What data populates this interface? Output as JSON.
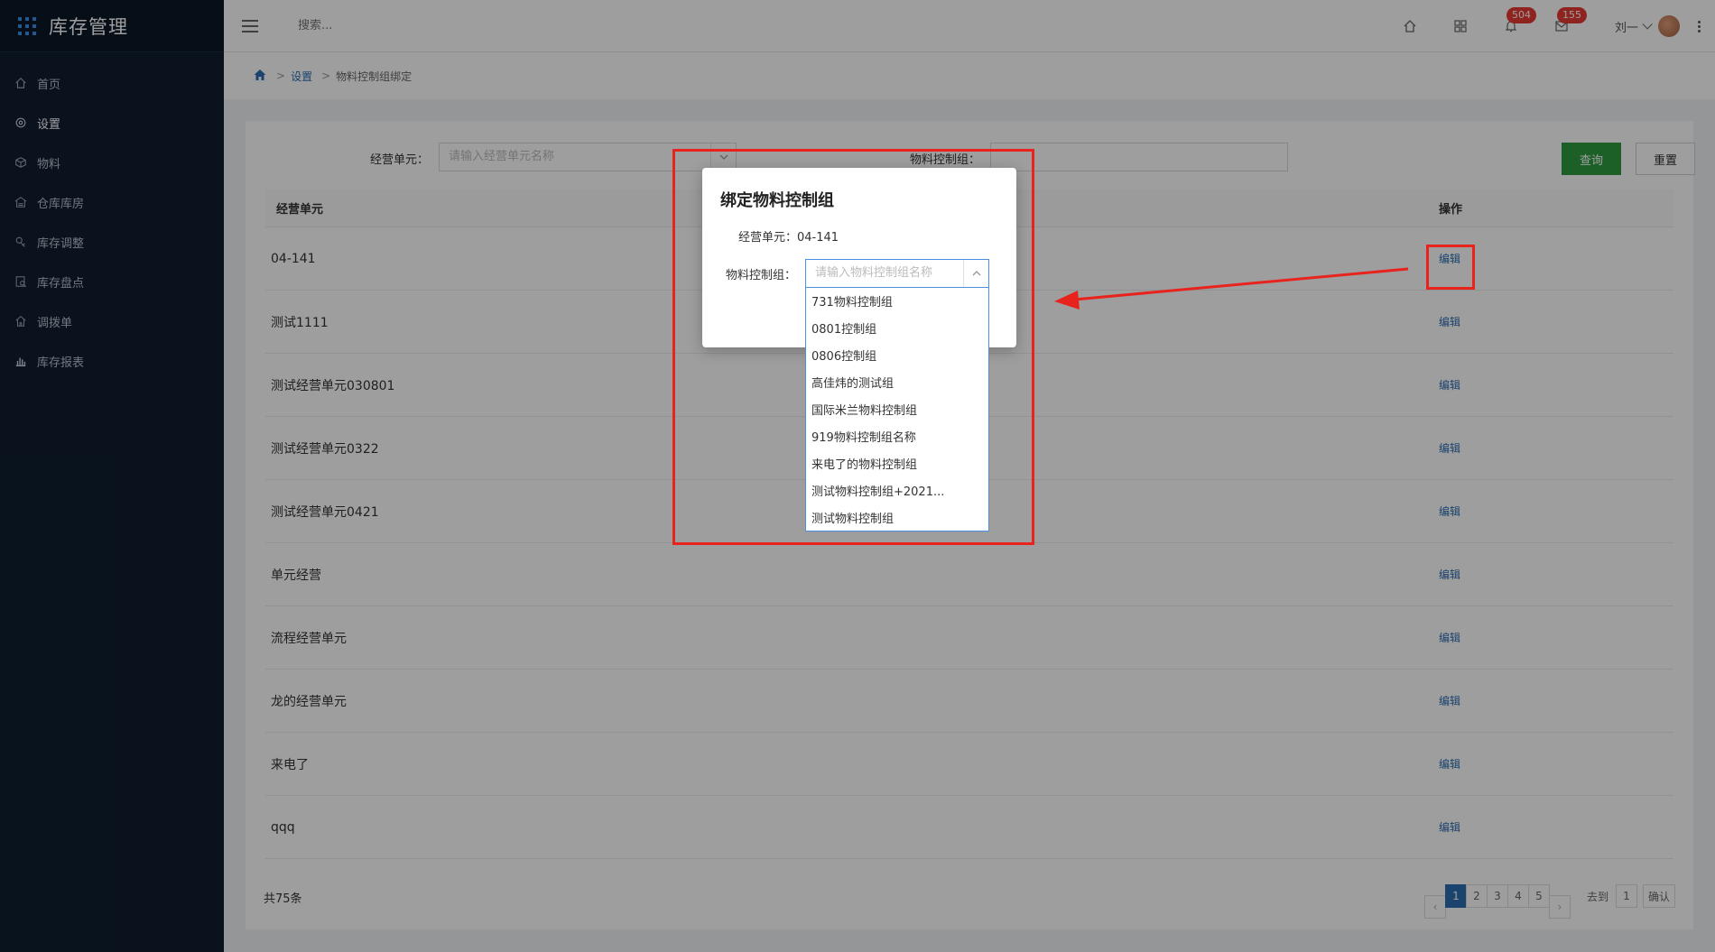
{
  "app": {
    "title": "库存管理"
  },
  "sidebar": {
    "items": [
      {
        "label": "首页",
        "icon": "home-icon"
      },
      {
        "label": "设置",
        "icon": "gear-icon"
      },
      {
        "label": "物料",
        "icon": "cube-icon"
      },
      {
        "label": "仓库库房",
        "icon": "warehouse-icon"
      },
      {
        "label": "库存调整",
        "icon": "adjust-icon"
      },
      {
        "label": "库存盘点",
        "icon": "inventory-icon"
      },
      {
        "label": "调拨单",
        "icon": "transfer-icon"
      },
      {
        "label": "库存报表",
        "icon": "bar-chart-icon"
      }
    ]
  },
  "header": {
    "search_placeholder": "搜索...",
    "notifications": "504",
    "messages": "155",
    "user": "刘一"
  },
  "breadcrumb": {
    "section": "设置",
    "page": "物料控制组绑定",
    "sep": ">"
  },
  "filter": {
    "unit_label": "经营单元：",
    "unit_placeholder": "请输入经营单元名称",
    "group_label": "物料控制组：",
    "query": "查询",
    "reset": "重置"
  },
  "table": {
    "col_unit": "经营单元",
    "col_op": "操作",
    "edit": "编辑",
    "rows": [
      "04-141",
      "测试1111",
      "测试经营单元030801",
      "测试经营单元0322",
      "测试经营单元0421",
      "单元经营",
      "流程经营单元",
      "龙的经营单元",
      "来电了",
      "qqq"
    ]
  },
  "pagination": {
    "total": "共75条",
    "pages": [
      "1",
      "2",
      "3",
      "4",
      "5"
    ],
    "goto_label": "去到",
    "goto_value": "1",
    "confirm": "确认"
  },
  "modal": {
    "title": "绑定物料控制组",
    "unit_text": "经营单元：04-141",
    "group_label": "物料控制组：",
    "group_placeholder": "请输入物料控制组名称",
    "options": [
      "731物料控制组",
      "0801控制组",
      "0806控制组",
      "高佳炜的测试组",
      "国际米兰物料控制组",
      "919物料控制组名称",
      "来电了的物料控制组",
      "测试物料控制组+2021...",
      "测试物料控制组"
    ]
  },
  "colors": {
    "sidebar_bg": "#0f1e30",
    "accent_blue": "#2b6cb0",
    "query_green": "#2e9a3f",
    "badge_red": "#e53935",
    "annotation_red": "#e8231d"
  }
}
